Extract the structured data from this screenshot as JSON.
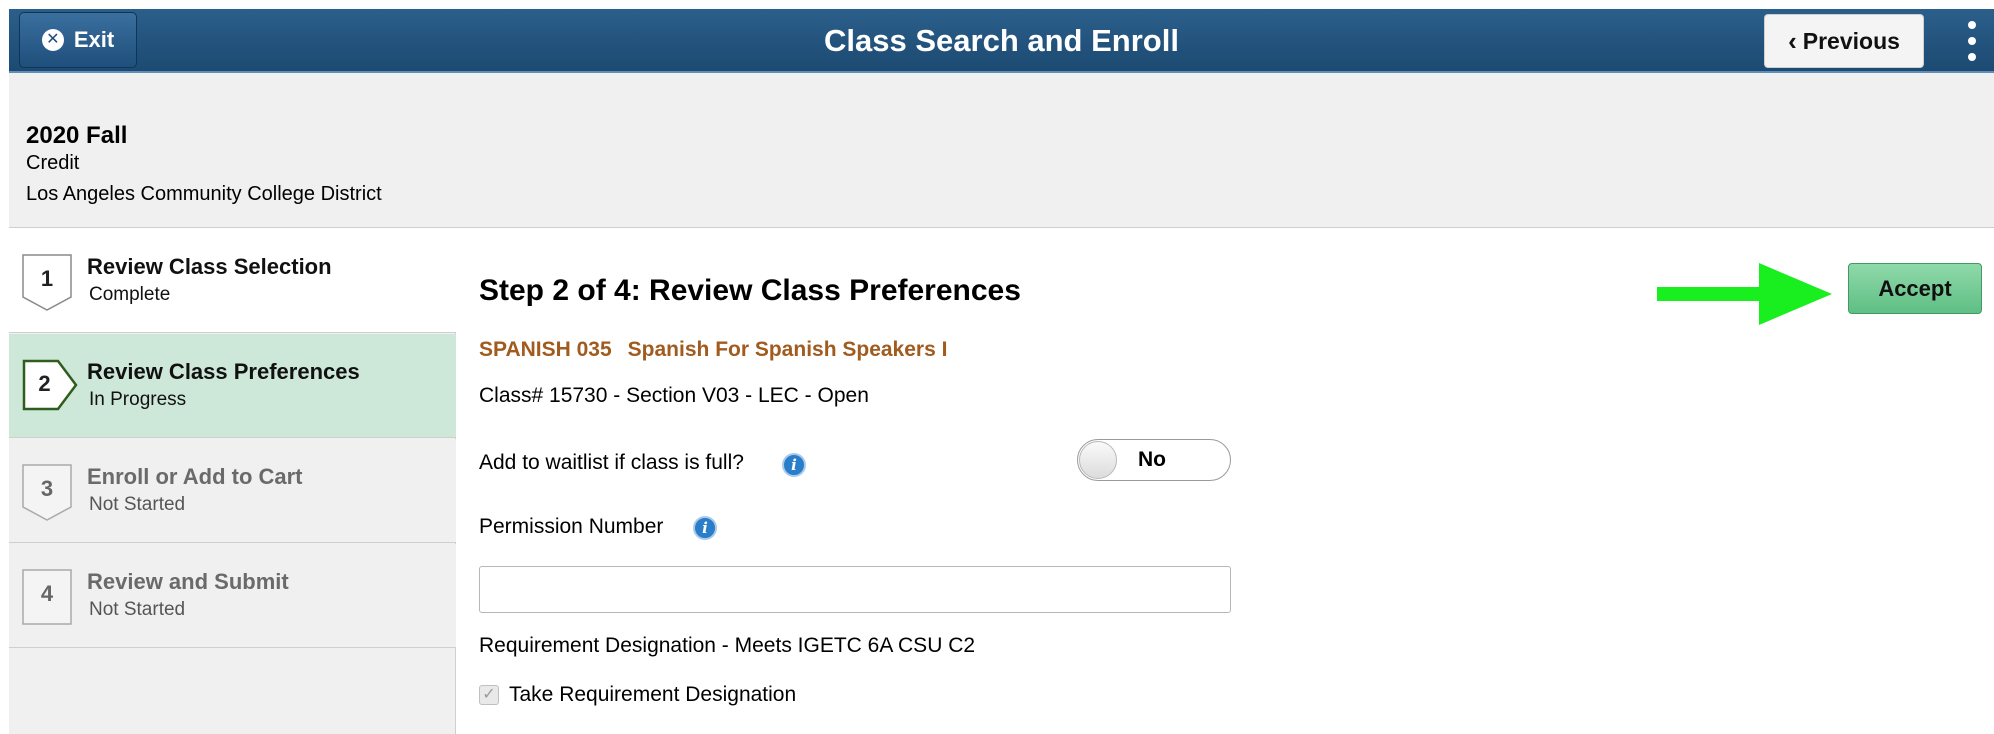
{
  "header": {
    "title": "Class Search and Enroll",
    "exit_label": "Exit",
    "previous_label": "Previous",
    "bg_color": "#1f4f7b"
  },
  "term_info": {
    "term": "2020 Fall",
    "career": "Credit",
    "institution": "Los Angeles Community College District"
  },
  "steps": [
    {
      "number": "1",
      "title": "Review Class Selection",
      "status": "Complete"
    },
    {
      "number": "2",
      "title": "Review Class Preferences",
      "status": "In Progress",
      "active": true
    },
    {
      "number": "3",
      "title": "Enroll or Add to Cart",
      "status": "Not Started"
    },
    {
      "number": "4",
      "title": "Review and Submit",
      "status": "Not Started"
    }
  ],
  "main": {
    "heading": "Step 2 of 4: Review Class Preferences",
    "course_code": "SPANISH 035",
    "course_title": "Spanish For Spanish Speakers I",
    "class_info": "Class# 15730 - Section V03 - LEC - Open",
    "waitlist_label": "Add to waitlist if class is full?",
    "waitlist_value": "No",
    "permission_label": "Permission Number",
    "permission_value": "",
    "requirement_designation": "Requirement Designation - Meets IGETC 6A CSU C2",
    "take_requirement_label": "Take Requirement Designation",
    "take_requirement_checked": true,
    "accept_label": "Accept",
    "accept_color": "#6cc38f",
    "arrow_color": "#19ee1f",
    "course_color": "#a15b1e",
    "active_step_color": "#cde8d9"
  },
  "icons": {
    "exit": "close-icon",
    "previous": "chevron-left-icon",
    "menu": "more-vertical-icon",
    "info": "info-icon",
    "arrow": "arrow-right-icon"
  }
}
